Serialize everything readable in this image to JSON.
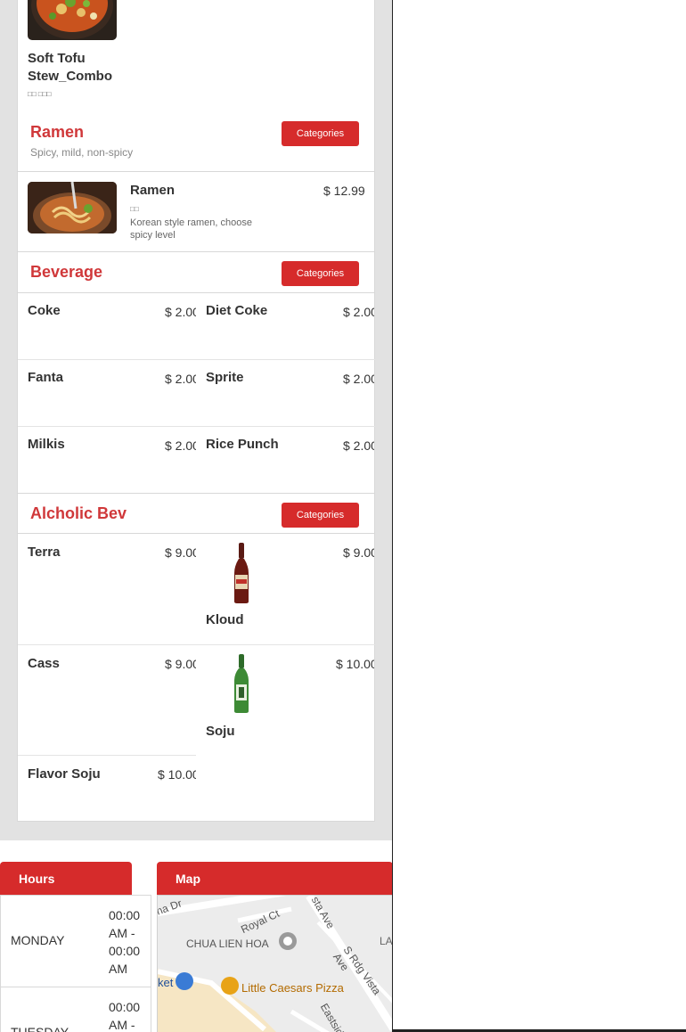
{
  "top_item": {
    "name": "Soft Tofu Stew_Combo",
    "subtext": "□□ □□□"
  },
  "ramen_section": {
    "title": "Ramen",
    "subtitle": "Spicy, mild, non-spicy",
    "button": "Categories",
    "item": {
      "name": "Ramen",
      "price": "$ 12.99",
      "korean": "□□",
      "description": "Korean style ramen, choose spicy level"
    }
  },
  "beverage_section": {
    "title": "Beverage",
    "button": "Categories",
    "items": [
      {
        "name": "Coke",
        "price": "$ 2.00"
      },
      {
        "name": "Diet Coke",
        "price": "$ 2.00"
      },
      {
        "name": "Fanta",
        "price": "$ 2.00"
      },
      {
        "name": "Sprite",
        "price": "$ 2.00"
      },
      {
        "name": "Milkis",
        "price": "$ 2.00"
      },
      {
        "name": "Rice Punch",
        "price": "$ 2.00"
      }
    ]
  },
  "alcohol_section": {
    "title": "Alcholic Bev",
    "button": "Categories",
    "items": [
      {
        "name": "Terra",
        "price": "$ 9.00"
      },
      {
        "name": "Kloud",
        "price": "$ 9.00"
      },
      {
        "name": "Cass",
        "price": "$ 9.00"
      },
      {
        "name": "Soju",
        "price": "$ 10.00"
      },
      {
        "name": "Flavor Soju",
        "price": "$ 10.00"
      }
    ]
  },
  "hours": {
    "header": "Hours",
    "rows": [
      {
        "day": "MONDAY",
        "time": "00:00 AM - 00:00 AM"
      },
      {
        "day": "TUESDAY",
        "time": "00:00 AM -"
      }
    ]
  },
  "map": {
    "header": "Map",
    "labels": {
      "street1": "na Dr",
      "street2": "Royal Ct",
      "street3": "sta Ave",
      "poi1": "CHUA LIEN HOA",
      "poi2": "LA",
      "street4": "S Rdg Vista Ave",
      "poi3": "ket",
      "poi4": "Little Caesars Pizza",
      "street5": "Eastsid"
    }
  },
  "colors": {
    "accent": "#d62b2b",
    "title_red": "#d0383a"
  }
}
